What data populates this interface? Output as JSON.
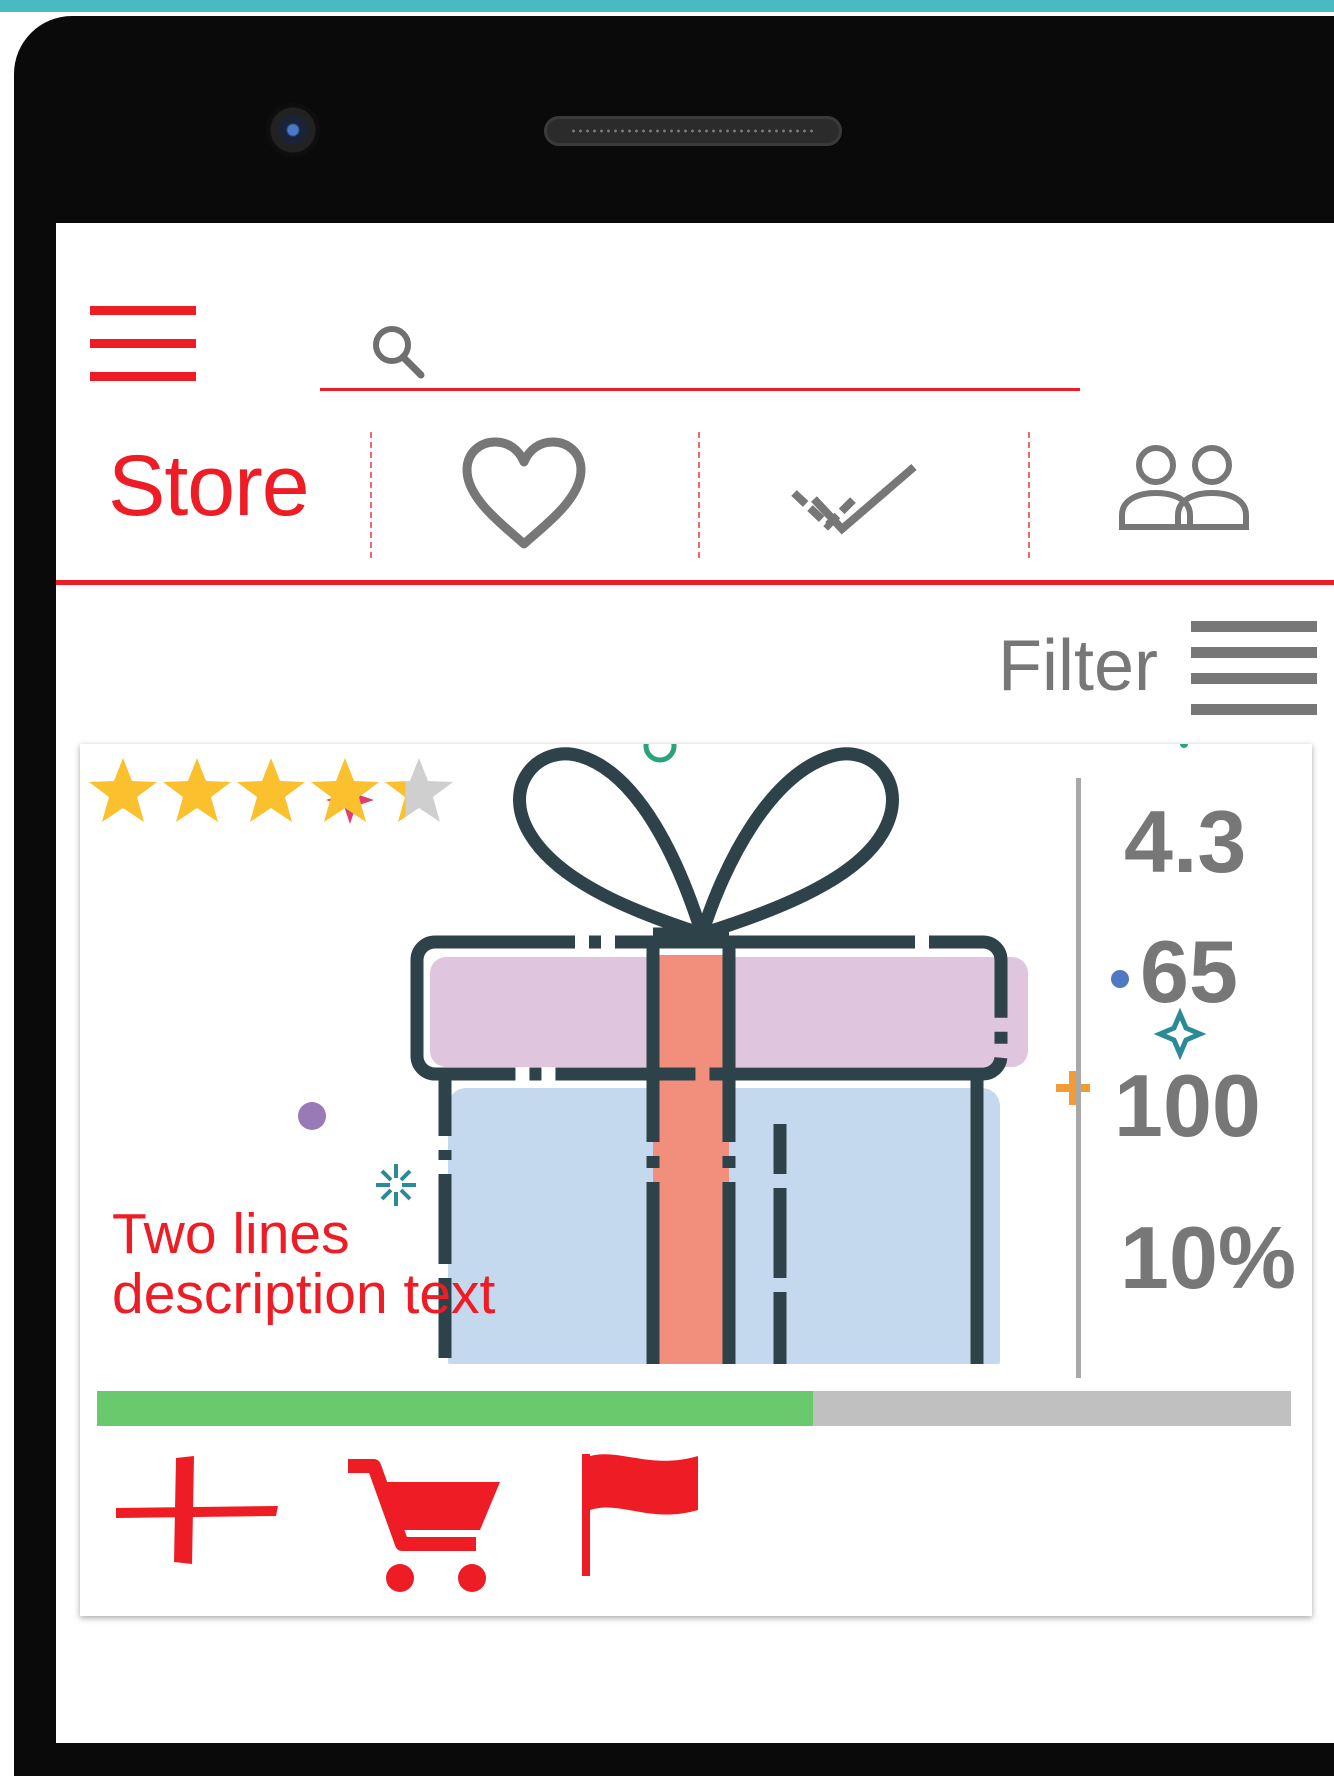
{
  "header": {
    "menu_icon": "hamburger-menu-icon",
    "search": {
      "icon": "search-icon",
      "value": "",
      "placeholder": ""
    }
  },
  "tabs": [
    {
      "label": "Store",
      "active": true
    },
    {
      "icon": "heart-icon"
    },
    {
      "icon": "double-check-icon"
    },
    {
      "icon": "users-icon"
    }
  ],
  "filter": {
    "label": "Filter",
    "icon": "filter-list-icon"
  },
  "product": {
    "rating": {
      "value": 4.3,
      "max": 5
    },
    "image": "gift-box-illustration",
    "description": "Two lines description text",
    "stats": {
      "rating": "4.3",
      "count": "65",
      "total": "100",
      "discount": "10%"
    },
    "progress_fraction": 0.6,
    "actions": [
      {
        "icon": "plus-icon"
      },
      {
        "icon": "cart-icon"
      },
      {
        "icon": "flag-icon"
      }
    ]
  },
  "colors": {
    "accent": "#ee1c24",
    "muted": "#777777",
    "star": "#fbc02d",
    "progress": "#6bc96d",
    "frame": "#49b9c2"
  }
}
